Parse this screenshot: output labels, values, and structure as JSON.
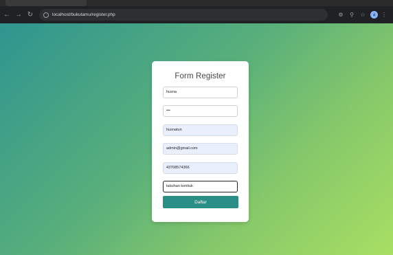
{
  "browser": {
    "url": "localhost/bukutamu/register.php",
    "profile_initial": "a"
  },
  "form": {
    "title": "Form Register",
    "username": "husna",
    "password": "•••",
    "nama": "husnatun",
    "email": "admin@gmail.com",
    "telepon": "43708574366",
    "tujuan": "tabuhan kontiuk",
    "submit_label": "Daftar"
  },
  "colors": {
    "accent": "#2a8d86",
    "gradient_start": "#2e9590",
    "gradient_end": "#a8df63"
  }
}
